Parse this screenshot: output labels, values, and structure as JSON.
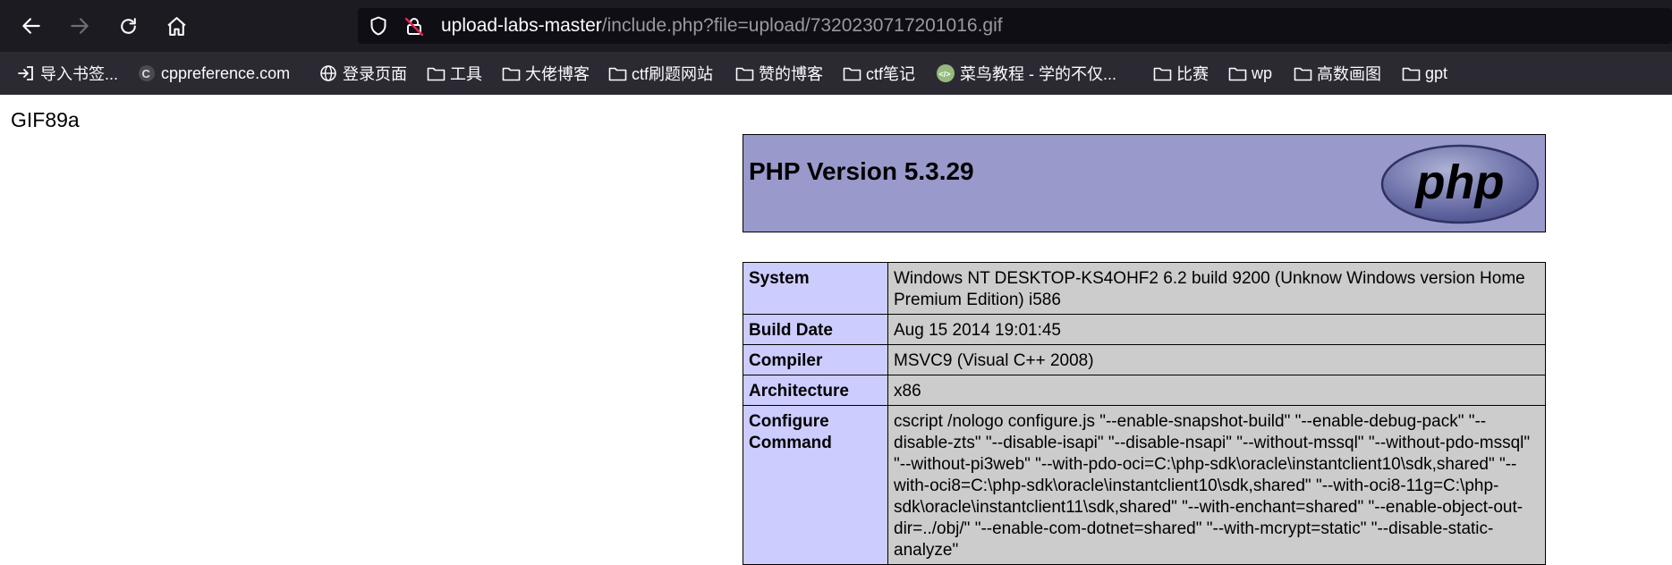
{
  "browser": {
    "url_host": "upload-labs-master",
    "url_rest": "/include.php?file=upload/7320230717201016.gif",
    "nav_icons": [
      "back-arrow-icon",
      "forward-arrow-icon",
      "reload-icon",
      "home-icon"
    ],
    "bookmarks": [
      {
        "label": "导入书签...",
        "icon": "import-icon"
      },
      {
        "label": "cppreference.com",
        "icon": "site-icon"
      },
      {
        "label": "登录页面",
        "icon": "globe-icon"
      },
      {
        "label": "工具",
        "icon": "folder-icon"
      },
      {
        "label": "大佬博客",
        "icon": "folder-icon"
      },
      {
        "label": "ctf刷题网站",
        "icon": "folder-icon"
      },
      {
        "label": "赞的博客",
        "icon": "folder-icon"
      },
      {
        "label": "ctf笔记",
        "icon": "folder-icon"
      },
      {
        "label": "菜鸟教程 - 学的不仅...",
        "icon": "runoob-icon"
      },
      {
        "label": "比赛",
        "icon": "folder-icon"
      },
      {
        "label": "wp",
        "icon": "folder-icon"
      },
      {
        "label": "高数画图",
        "icon": "folder-icon"
      },
      {
        "label": "gpt",
        "icon": "folder-icon"
      }
    ]
  },
  "page": {
    "gif_header": "GIF89a",
    "php_title": "PHP Version 5.3.29",
    "logo_text": "php",
    "rows": [
      {
        "key": "System",
        "value": "Windows NT DESKTOP-KS4OHF2 6.2 build 9200 (Unknow Windows version Home Premium Edition) i586"
      },
      {
        "key": "Build Date",
        "value": "Aug 15 2014 19:01:45"
      },
      {
        "key": "Compiler",
        "value": "MSVC9 (Visual C++ 2008)"
      },
      {
        "key": "Architecture",
        "value": "x86"
      },
      {
        "key": "Configure Command",
        "value": "cscript /nologo configure.js \"--enable-snapshot-build\" \"--enable-debug-pack\" \"--disable-zts\" \"--disable-isapi\" \"--disable-nsapi\" \"--without-mssql\" \"--without-pdo-mssql\" \"--without-pi3web\" \"--with-pdo-oci=C:\\php-sdk\\oracle\\instantclient10\\sdk,shared\" \"--with-oci8=C:\\php-sdk\\oracle\\instantclient10\\sdk,shared\" \"--with-oci8-11g=C:\\php-sdk\\oracle\\instantclient11\\sdk,shared\" \"--with-enchant=shared\" \"--enable-object-out-dir=../obj/\" \"--enable-com-dotnet=shared\" \"--with-mcrypt=static\" \"--disable-static-analyze\""
      }
    ]
  },
  "colors": {
    "chrome_bg": "#1c1b22",
    "bookmarks_bg": "#2b2a33",
    "php_header_bg": "#9999cc",
    "key_cell_bg": "#ccccff",
    "value_cell_bg": "#cccccc"
  }
}
